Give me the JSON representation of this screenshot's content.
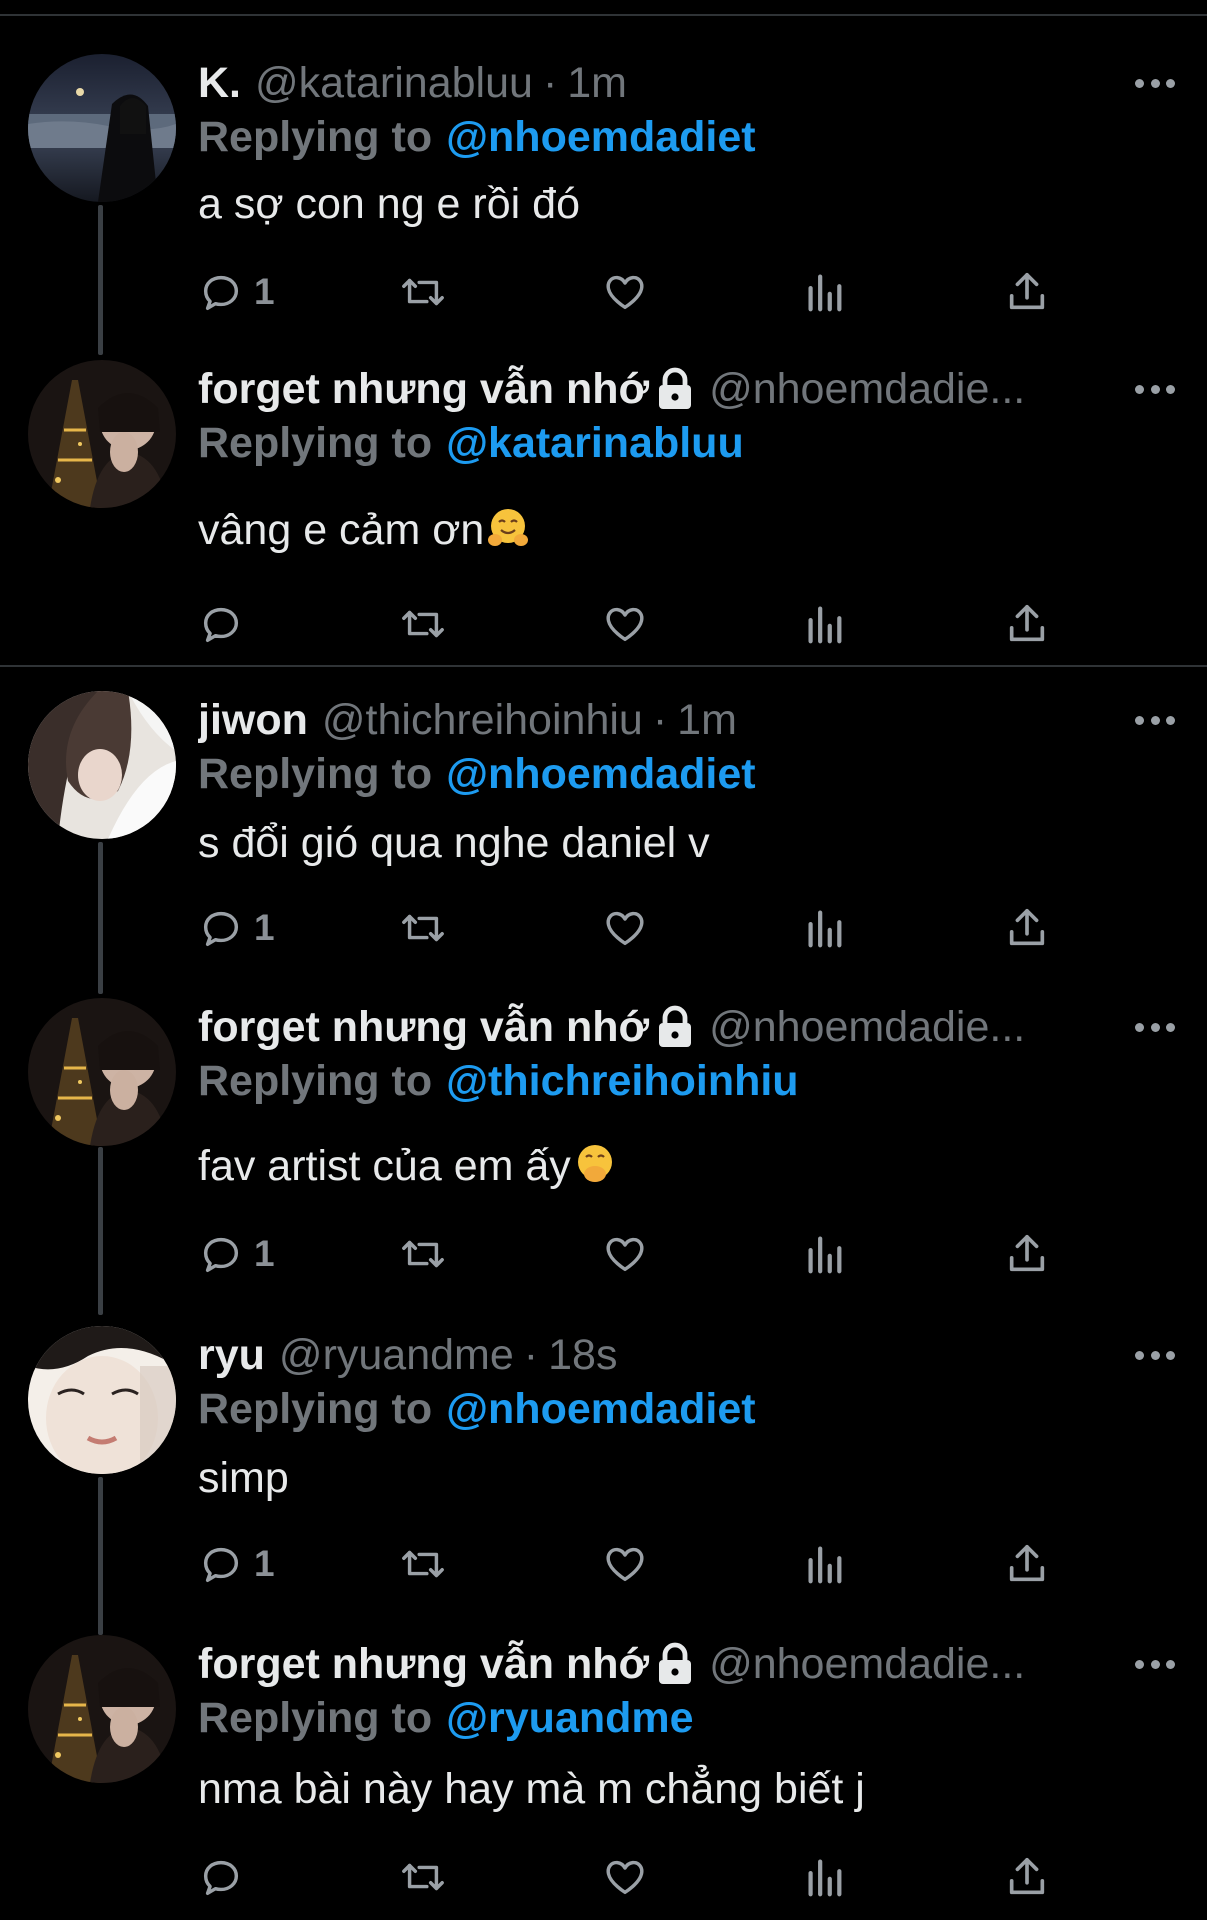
{
  "tweets": [
    {
      "name": "K.",
      "handle": "@katarinabluu",
      "separator": "·",
      "time": "1m",
      "replying_label": "Replying to",
      "replying_to": "@nhoemdadiet",
      "text": "a sợ con ng e rồi đó",
      "reply_count": "1",
      "locked": false,
      "avatar": "night-sea"
    },
    {
      "name": "forget nhưng vẫn nhớ",
      "handle": "@nhoemdadie...",
      "separator": "",
      "time": "",
      "replying_label": "Replying to",
      "replying_to": "@katarinabluu",
      "text": "vâng e cảm ơn",
      "emoji": "hugging-face",
      "reply_count": "",
      "locked": true,
      "avatar": "eiffel-night"
    },
    {
      "name": "jiwon",
      "handle": "@thichreihoinhiu",
      "separator": "·",
      "time": "1m",
      "replying_label": "Replying to",
      "replying_to": "@nhoemdadiet",
      "text": "s đổi gió qua nghe daniel v",
      "reply_count": "1",
      "locked": false,
      "avatar": "girl-light"
    },
    {
      "name": "forget nhưng vẫn nhớ",
      "handle": "@nhoemdadie...",
      "separator": "",
      "time": "",
      "replying_label": "Replying to",
      "replying_to": "@thichreihoinhiu",
      "text": "fav artist của em ấy",
      "emoji": "hand-over-mouth",
      "reply_count": "1",
      "locked": true,
      "avatar": "eiffel-night"
    },
    {
      "name": "ryu",
      "handle": "@ryuandme",
      "separator": "·",
      "time": "18s",
      "replying_label": "Replying to",
      "replying_to": "@nhoemdadiet",
      "text": "simp",
      "reply_count": "1",
      "locked": false,
      "avatar": "face-closeup"
    },
    {
      "name": "forget nhưng vẫn nhớ",
      "handle": "@nhoemdadie...",
      "separator": "",
      "time": "",
      "replying_label": "Replying to",
      "replying_to": "@ryuandme",
      "text": "nma bài này hay mà m chẳng biết j",
      "reply_count": "",
      "locked": true,
      "avatar": "eiffel-night"
    }
  ],
  "icons": [
    "reply-icon",
    "retweet-icon",
    "like-icon",
    "analytics-icon",
    "share-icon",
    "more-icon",
    "lock-icon"
  ],
  "colors": {
    "background": "#000000",
    "text": "#e7e9ea",
    "muted": "#71767b",
    "link": "#1d9bf0",
    "divider": "#2f3336"
  }
}
